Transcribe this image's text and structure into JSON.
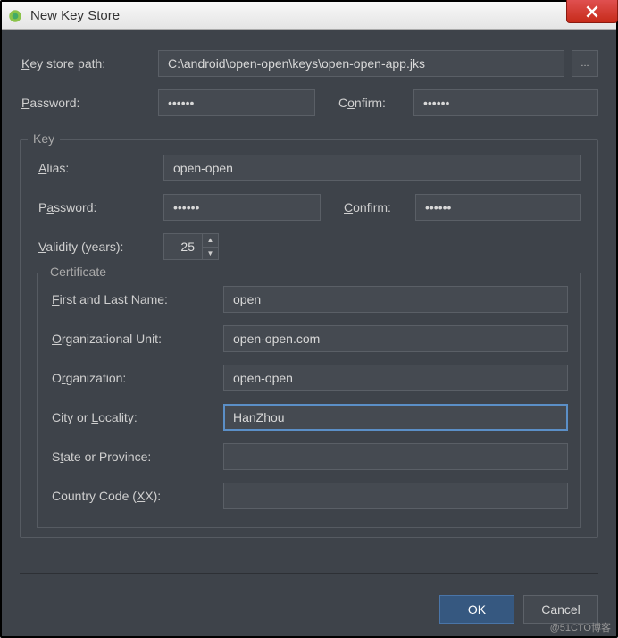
{
  "window": {
    "title": "New Key Store",
    "close_icon": "×"
  },
  "fields": {
    "key_store_path_label": "Key store path:",
    "key_store_path_value": "C:\\android\\open-open\\keys\\open-open-app.jks",
    "browse_label": "...",
    "password_label": "Password:",
    "password_value": "••••••",
    "confirm_label": "Confirm:",
    "confirm_value": "••••••"
  },
  "key_group": {
    "title": "Key",
    "alias_label": "Alias:",
    "alias_value": "open-open",
    "password_label": "Password:",
    "password_value": "••••••",
    "confirm_label": "Confirm:",
    "confirm_value": "••••••",
    "validity_label": "Validity (years):",
    "validity_value": "25"
  },
  "certificate": {
    "title": "Certificate",
    "first_last_label": "First and Last Name:",
    "first_last_value": "open",
    "org_unit_label": "Organizational Unit:",
    "org_unit_value": "open-open.com",
    "org_label": "Organization:",
    "org_value": "open-open",
    "city_label": "City or Locality:",
    "city_value": "HanZhou",
    "state_label": "State or Province:",
    "state_value": "",
    "country_label": "Country Code (XX):",
    "country_value": ""
  },
  "buttons": {
    "ok": "OK",
    "cancel": "Cancel"
  },
  "watermark": "@51CTO博客"
}
